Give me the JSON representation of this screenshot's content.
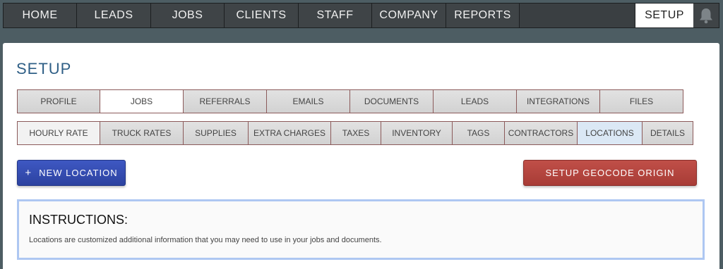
{
  "nav": {
    "items": [
      "HOME",
      "LEADS",
      "JOBS",
      "CLIENTS",
      "STAFF",
      "COMPANY",
      "REPORTS"
    ],
    "active": "SETUP",
    "bell_icon": "bell-icon"
  },
  "page": {
    "title": "SETUP"
  },
  "tabs_primary": [
    "PROFILE",
    "JOBS",
    "REFERRALS",
    "EMAILS",
    "DOCUMENTS",
    "LEADS",
    "INTEGRATIONS",
    "FILES"
  ],
  "tabs_secondary": [
    "HOURLY RATE",
    "TRUCK RATES",
    "SUPPLIES",
    "EXTRA CHARGES",
    "TAXES",
    "INVENTORY",
    "TAGS",
    "CONTRACTORS",
    "LOCATIONS",
    "DETAILS"
  ],
  "actions": {
    "new_location": "NEW LOCATION",
    "plus": "+",
    "geocode": "SETUP GEOCODE ORIGIN"
  },
  "instructions": {
    "title": "INSTRUCTIONS:",
    "text": "Locations are customized additional information that you may need to use in your jobs and documents."
  },
  "colors": {
    "title": "#2f5f86",
    "primary_button": "#3449b0",
    "danger_button": "#b5443e",
    "instructions_border": "#aec7f2"
  }
}
